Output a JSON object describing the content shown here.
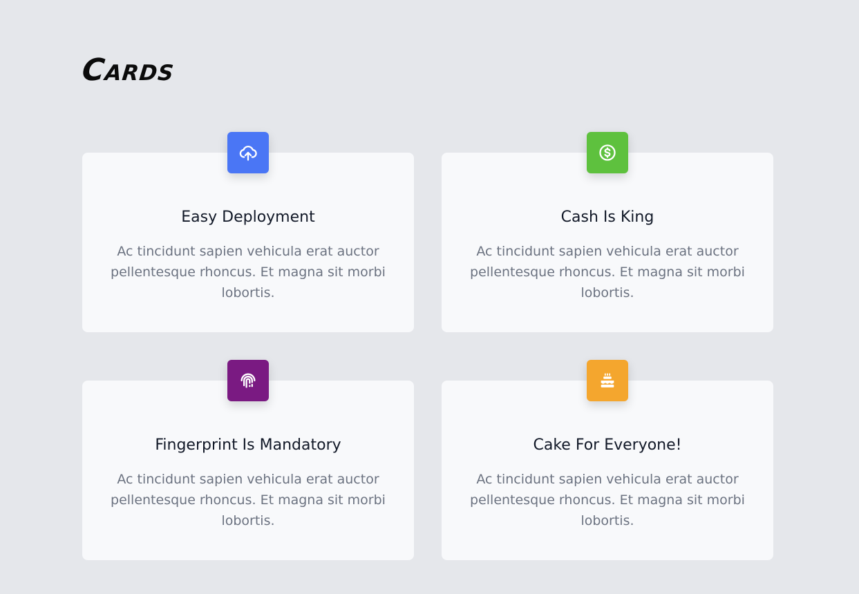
{
  "page": {
    "title": "Cards"
  },
  "cards": [
    {
      "title": "Easy Deployment",
      "text": "Ac tincidunt sapien vehicula erat auctor pellentesque rhoncus. Et magna sit morbi lobortis.",
      "icon": "cloud-upload-icon",
      "color": "#4a76f5"
    },
    {
      "title": "Cash Is King",
      "text": "Ac tincidunt sapien vehicula erat auctor pellentesque rhoncus. Et magna sit morbi lobortis.",
      "icon": "dollar-circle-icon",
      "color": "#5ec13e"
    },
    {
      "title": "Fingerprint Is Mandatory",
      "text": "Ac tincidunt sapien vehicula erat auctor pellentesque rhoncus. Et magna sit morbi lobortis.",
      "icon": "fingerprint-icon",
      "color": "#7a1a82"
    },
    {
      "title": "Cake For Everyone!",
      "text": "Ac tincidunt sapien vehicula erat auctor pellentesque rhoncus. Et magna sit morbi lobortis.",
      "icon": "cake-icon",
      "color": "#f4a62e"
    }
  ]
}
